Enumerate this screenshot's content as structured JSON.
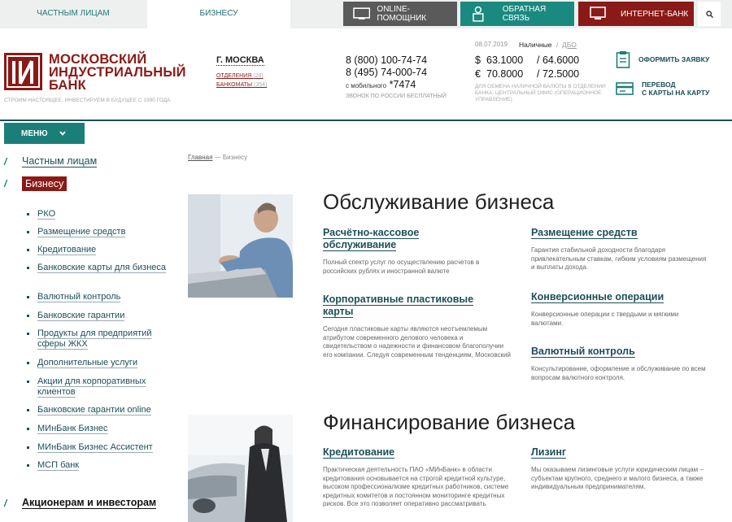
{
  "top_tabs": [
    {
      "label": "Частным лицам"
    },
    {
      "label": "Бизнесу"
    }
  ],
  "top_buttons": {
    "online": "Online-помощник",
    "feedback": "Обратная связь",
    "netbank": "Интернет-банк"
  },
  "colors": {
    "accent": "#1a7f78",
    "brand": "#8a1a17",
    "dark": "#1d4e5a",
    "online_bg": "#5a5a5a",
    "feedback_bg": "#1a8a80",
    "netbank_bg": "#8a1a17"
  },
  "logo": {
    "line1": "Московский",
    "line2": "индустриальный",
    "line3": "банк",
    "slogan": "Строим настоящее, инвестируем в будущее с 1990 года"
  },
  "city": {
    "name": "г. Москва",
    "branches_label": "Отделения",
    "branches_count": "(28)",
    "atms_label": "Банкоматы",
    "atms_count": "(354)"
  },
  "phones": {
    "p1": "8 (800) 100-74-74",
    "p2": "8 (495) 74-000-74",
    "mobile_label": "с мобильного",
    "mobile": "*7474",
    "note": "Звонок по России бесплатный"
  },
  "rates": {
    "date": "08.07.2019",
    "tab_cash": "Наличные",
    "tab_sep": "/",
    "tab_dbo": "ДБО",
    "usd_symbol": "$",
    "usd_buy": "63.1000",
    "usd_sell": "/ 64.6000",
    "eur_symbol": "€",
    "eur_buy": "70.8000",
    "eur_sell": "/ 72.5000",
    "note": "Для обмена наличной валюты в отделении банка: Центральный офис (операционное управление)"
  },
  "actions": {
    "apply": "Оформить заявку",
    "transfer_line1": "Перевод",
    "transfer_line2": "с карты на карту"
  },
  "menu_label": "Меню",
  "left_nav": {
    "private": "Частным лицам",
    "business": "Бизнесу",
    "investors": "Акционерам и инвесторам",
    "sub": [
      "РКО",
      "Размещение средств",
      "Кредитование",
      "Банковские карты для бизнеса",
      "Валютный контроль",
      "Банковские гарантии",
      "Продукты для предприятий сферы ЖКХ",
      "Дополнительные услуги",
      "Акции для корпоративных клиентов",
      "Банковские гарантии online",
      "МИнБанк Бизнес",
      "МИнБанк Бизнес Ассистент",
      "МСП банк"
    ]
  },
  "breadcrumb": {
    "home": "Главная",
    "sep": "—",
    "current": "Бизнесу"
  },
  "sections": {
    "service": {
      "title": "Обслуживание бизнеса",
      "c1_title": "Расчётно-кассовое обслуживание",
      "c1_text": "Полный спектр услуг по осуществлению расчетов в российских рублях и иностранной валюте",
      "c2_title": "Размещение средств",
      "c2_text": "Гарантия стабильной доходности благодаря привлекательным ставкам, гибким условиям размещения и выплаты дохода.",
      "c3_title": "Корпоративные пластиковые карты",
      "c3_text": "Сегодня пластиковые карты являются неотъемлемым атрибутом современного делового человека и свидетельством о надежности и финансовом благополучии его компании. Следуя современным тенденциям, Московский",
      "c4_title": "Конверсионные операции",
      "c4_text": "Конверсионные операции с твердыми и мягкими валютами.",
      "c5_title": "Валютный контроль",
      "c5_text": "Консультирование, оформление и обслуживание по всем вопросам валютного контроля."
    },
    "finance": {
      "title": "Финансирование бизнеса",
      "c1_title": "Кредитование",
      "c1_text": "Практическая деятельность ПАО «МИнБанк» в области кредитования основывается на строгой кредитной культуре, высоком профессионализме кредитных работников, системе кредитных комитетов и постоянном мониторинге кредитных рисков. Все это позволяет оперативно рассматривать",
      "c2_title": "Лизинг",
      "c2_text": "Мы оказываем лизинговые услуги юридическим лицам – субъектам крупного, среднего и малого бизнеса, а также индивидуальным предпринимателям."
    }
  }
}
